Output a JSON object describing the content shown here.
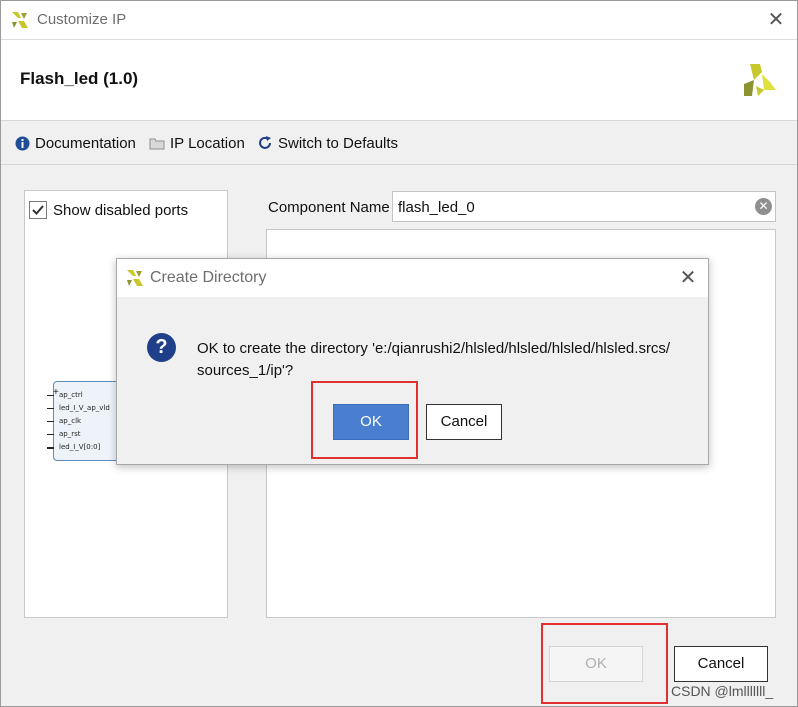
{
  "window": {
    "title": "Customize IP",
    "ip_name": "Flash_led (1.0)"
  },
  "toolbar": {
    "documentation": "Documentation",
    "ip_location": "IP Location",
    "switch_defaults": "Switch to Defaults"
  },
  "left_panel": {
    "show_disabled_ports_label": "Show disabled ports",
    "show_disabled_ports_checked": true,
    "symbol_ports": [
      "ap_ctrl",
      "led_I_V_ap_vld",
      "ap_clk",
      "ap_rst",
      "led_I_V[0:0]"
    ]
  },
  "component": {
    "label": "Component Name",
    "value": "flash_led_0"
  },
  "buttons": {
    "ok": "OK",
    "cancel": "Cancel"
  },
  "dialog": {
    "title": "Create Directory",
    "message_line1": "OK to create the directory 'e:/qianrushi2/hlsled/hlsled/hlsled/hlsled.srcs/",
    "message_line2": "sources_1/ip'?",
    "ok": "OK",
    "cancel": "Cancel"
  },
  "watermark": "CSDN @lmlllllll_",
  "colors": {
    "accent_blue": "#4a7fcf",
    "highlight_red": "#e03030",
    "logo_yellow": "#c8c82a"
  }
}
